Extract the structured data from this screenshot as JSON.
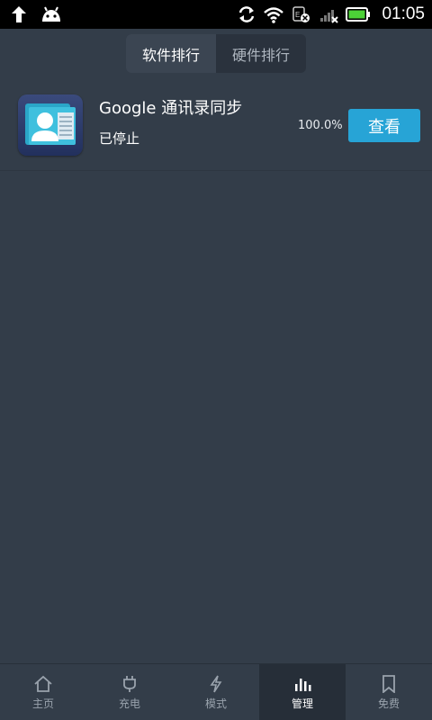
{
  "status_bar": {
    "time": "01:05",
    "icons": [
      "upload-arrow-icon",
      "android-icon",
      "sync-icon",
      "wifi-icon",
      "sim-icon",
      "signal-icon",
      "battery-icon"
    ]
  },
  "tabs": [
    {
      "label": "软件排行",
      "active": true
    },
    {
      "label": "硬件排行",
      "active": false
    }
  ],
  "app_list": [
    {
      "name": "Google 通讯录同步",
      "status": "已停止",
      "percent": "100.0%",
      "button_label": "查看",
      "icon": "contacts-icon"
    }
  ],
  "bottom_nav": [
    {
      "label": "主页",
      "icon": "home-icon",
      "active": false
    },
    {
      "label": "充电",
      "icon": "plug-icon",
      "active": false
    },
    {
      "label": "模式",
      "icon": "lightning-icon",
      "active": false
    },
    {
      "label": "管理",
      "icon": "bar-chart-icon",
      "active": true
    },
    {
      "label": "免费",
      "icon": "bookmark-icon",
      "active": false
    }
  ],
  "colors": {
    "background": "#333d49",
    "accent": "#27a4d6",
    "battery": "#4cd137"
  }
}
